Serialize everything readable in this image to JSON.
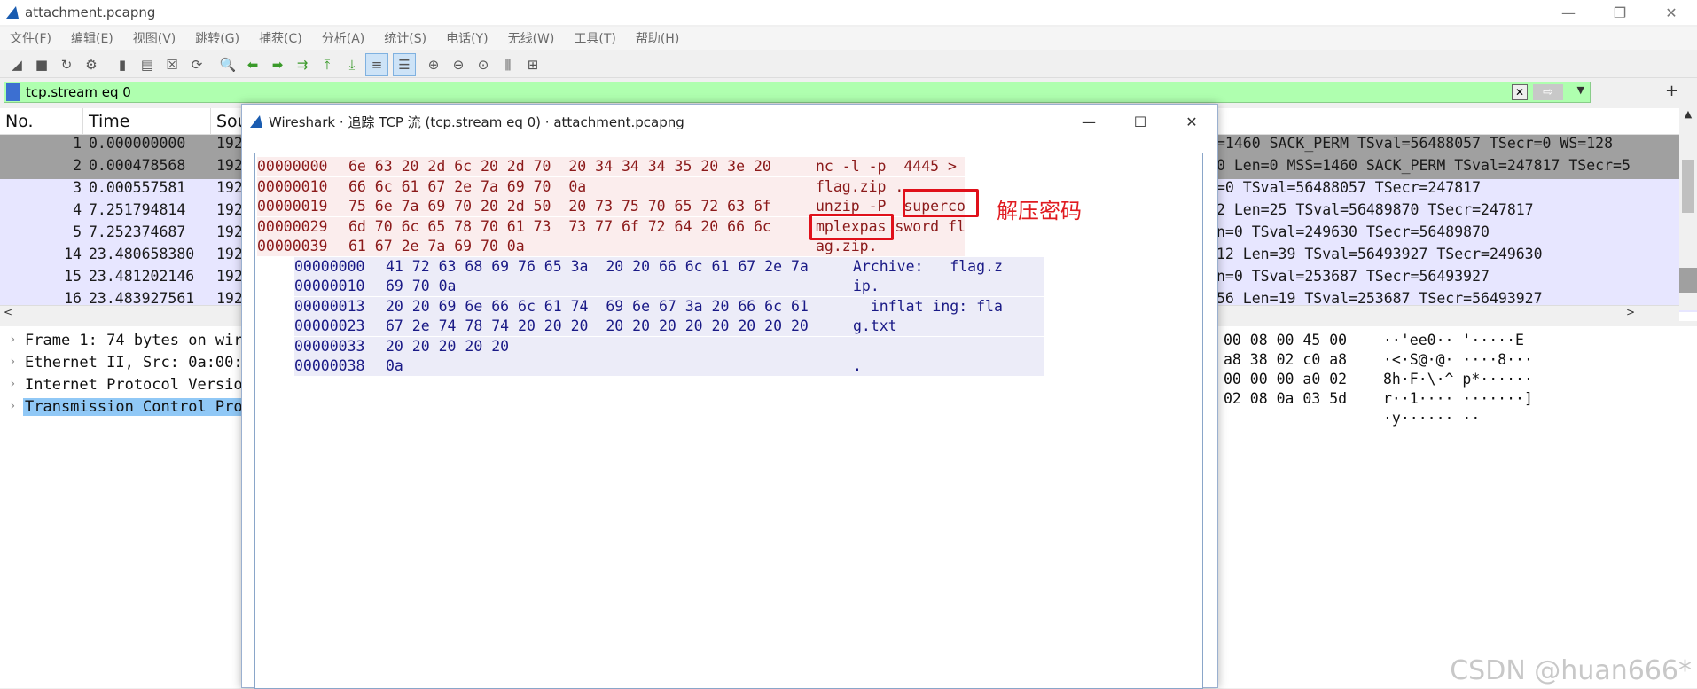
{
  "window": {
    "title": "attachment.pcapng",
    "controls": [
      "—",
      "❐",
      "✕"
    ]
  },
  "menu": [
    "文件(F)",
    "编辑(E)",
    "视图(V)",
    "跳转(G)",
    "捕获(C)",
    "分析(A)",
    "统计(S)",
    "电话(Y)",
    "无线(W)",
    "工具(T)",
    "帮助(H)"
  ],
  "filter": {
    "value": "tcp.stream eq 0",
    "plus": "+"
  },
  "packet_list": {
    "columns": [
      "No.",
      "Time",
      "Sou"
    ],
    "rows": [
      {
        "no": "1",
        "time": "0.000000000",
        "src": "192",
        "info": "=1460 SACK_PERM TSval=56488057 TSecr=0 WS=128",
        "selected": true
      },
      {
        "no": "2",
        "time": "0.000478568",
        "src": "192",
        "info": "0 Len=0 MSS=1460 SACK_PERM TSval=247817 TSecr=5",
        "selected": true
      },
      {
        "no": "3",
        "time": "0.000557581",
        "src": "192",
        "info": "=0 TSval=56488057 TSecr=247817",
        "selected": false
      },
      {
        "no": "4",
        "time": "7.251794814",
        "src": "192",
        "info": "2 Len=25 TSval=56489870 TSecr=247817",
        "selected": false
      },
      {
        "no": "5",
        "time": "7.252374687",
        "src": "192",
        "info": "n=0 TSval=249630 TSecr=56489870",
        "selected": false
      },
      {
        "no": "14",
        "time": "23.480658380",
        "src": "192",
        "info": "12 Len=39 TSval=56493927 TSecr=249630",
        "selected": false
      },
      {
        "no": "15",
        "time": "23.481202146",
        "src": "192",
        "info": "n=0 TSval=253687 TSecr=56493927",
        "selected": false
      },
      {
        "no": "16",
        "time": "23.483927561",
        "src": "192",
        "info": "56 Len=19 TSval=253687 TSecr=56493927",
        "selected": false
      }
    ]
  },
  "details": [
    {
      "text": "Frame 1: 74 bytes on wir",
      "selected": false
    },
    {
      "text": "Ethernet II, Src: 0a:00:",
      "selected": false
    },
    {
      "text": "Internet Protocol Versio",
      "selected": false
    },
    {
      "text": "Transmission Control Pro",
      "selected": true
    }
  ],
  "hex_pane": [
    {
      "hex": "00 08 00 45 00",
      "ascii": "··'ee0·· '·····E"
    },
    {
      "hex": "a8 38 02 c0 a8",
      "ascii": "·<·S@·@· ····8···"
    },
    {
      "hex": "00 00 00 a0 02",
      "ascii": "8h·F·\\·^ p*······"
    },
    {
      "hex": "02 08 0a 03 5d",
      "ascii": "r··1···· ·······]"
    },
    {
      "hex": "",
      "ascii": "·y······ ··"
    }
  ],
  "dialog": {
    "title": "Wireshark · 追踪 TCP 流 (tcp.stream eq 0) · attachment.pcapng",
    "rows": [
      {
        "dir": "client",
        "offset": "00000000",
        "bytes": "6e 63 20 2d 6c 20 2d 70  20 34 34 34 35 20 3e 20",
        "ascii": "nc -l -p  4445 > "
      },
      {
        "dir": "client",
        "offset": "00000010",
        "bytes": "66 6c 61 67 2e 7a 69 70  0a",
        "ascii": "flag.zip ."
      },
      {
        "dir": "client",
        "offset": "00000019",
        "bytes": "75 6e 7a 69 70 20 2d 50  20 73 75 70 65 72 63 6f",
        "ascii": "unzip -P  superco"
      },
      {
        "dir": "client",
        "offset": "00000029",
        "bytes": "6d 70 6c 65 78 70 61 73  73 77 6f 72 64 20 66 6c",
        "ascii": "mplexpas sword fl"
      },
      {
        "dir": "client",
        "offset": "00000039",
        "bytes": "61 67 2e 7a 69 70 0a",
        "ascii": "ag.zip."
      },
      {
        "dir": "server",
        "offset": "00000000",
        "bytes": "41 72 63 68 69 76 65 3a  20 20 66 6c 61 67 2e 7a",
        "ascii": "Archive:   flag.z"
      },
      {
        "dir": "server",
        "offset": "00000010",
        "bytes": "69 70 0a",
        "ascii": "ip."
      },
      {
        "dir": "server",
        "offset": "00000013",
        "bytes": "20 20 69 6e 66 6c 61 74  69 6e 67 3a 20 66 6c 61",
        "ascii": "  inflat ing: fla"
      },
      {
        "dir": "server",
        "offset": "00000023",
        "bytes": "67 2e 74 78 74 20 20 20  20 20 20 20 20 20 20 20",
        "ascii": "g.txt"
      },
      {
        "dir": "server",
        "offset": "00000033",
        "bytes": "20 20 20 20 20",
        "ascii": ""
      },
      {
        "dir": "server",
        "offset": "00000038",
        "bytes": "0a",
        "ascii": "."
      }
    ],
    "annotation": "解压密码"
  },
  "watermark": "CSDN @huan666*",
  "colors": {
    "filter_bg": "#afffaf",
    "client_bg": "#fbeded",
    "client_fg": "#8b1a1a",
    "server_bg": "#ececf8",
    "server_fg": "#1a1a86",
    "highlight": "#e0101a"
  }
}
